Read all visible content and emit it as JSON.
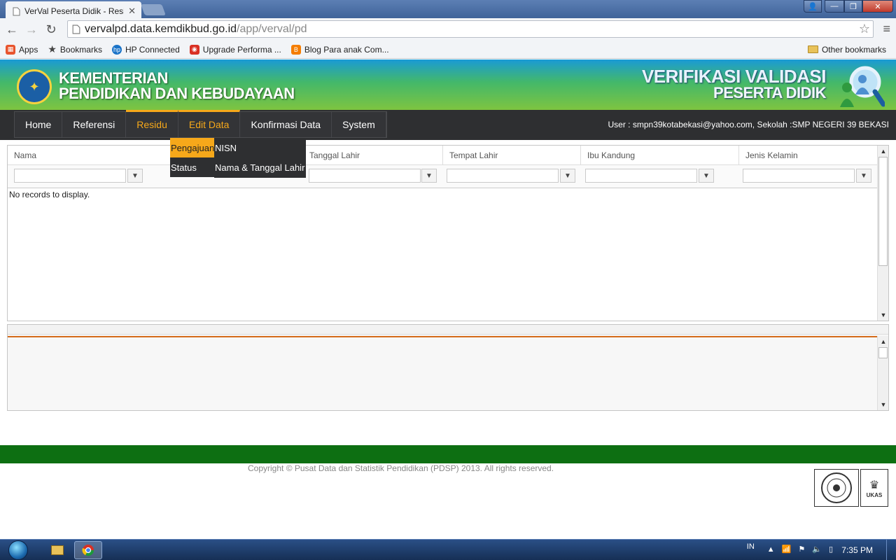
{
  "browser": {
    "tab_title": "VerVal Peserta Didik - Resi",
    "url_host": "vervalpd.data.kemdikbud.go.id",
    "url_path": "/app/verval/pd",
    "bookmarks": [
      {
        "label": "Apps",
        "icon": "apps-grid-icon",
        "color": "#e8542d"
      },
      {
        "label": "Bookmarks",
        "icon": "star-icon",
        "color": "#444444"
      },
      {
        "label": "HP Connected",
        "icon": "hp-logo-icon",
        "color": "#1a73c8"
      },
      {
        "label": "Upgrade Performa ...",
        "icon": "site-favicon-icon",
        "color": "#d93024"
      },
      {
        "label": "Blog Para anak Com...",
        "icon": "blogger-icon",
        "color": "#f57d00"
      }
    ],
    "other_bookmarks": "Other bookmarks"
  },
  "header": {
    "left_line1": "KEMENTERIAN",
    "left_line2": "PENDIDIKAN DAN KEBUDAYAAN",
    "right_line1": "VERIFIKASI VALIDASI",
    "right_line2": "PESERTA DIDIK"
  },
  "nav": {
    "items": [
      "Home",
      "Referensi",
      "Residu",
      "Edit Data",
      "Konfirmasi Data",
      "System"
    ],
    "user_info": "User : smpn39kotabekasi@yahoo.com, Sekolah :SMP NEGERI 39 BEKASI",
    "submenu": [
      "Pengajuan",
      "Status"
    ],
    "submenu2": [
      "NISN",
      "Nama & Tanggal Lahir"
    ]
  },
  "grid": {
    "columns": [
      "Nama",
      "Tanggal Lahir",
      "Tempat Lahir",
      "Ibu Kandung",
      "Jenis Kelamin"
    ],
    "empty_text": "No records to display."
  },
  "footer": {
    "copyright": "Copyright © Pusat Data dan Statistik Pendidikan (PDSP) 2013. All rights reserved.",
    "cert_label": "UKAS"
  },
  "taskbar": {
    "lang": "IN",
    "time": "7:35 PM"
  },
  "colors": {
    "accent": "#f6a81a",
    "footer_green": "#0d6f12",
    "orange_line": "#d46b1a"
  }
}
